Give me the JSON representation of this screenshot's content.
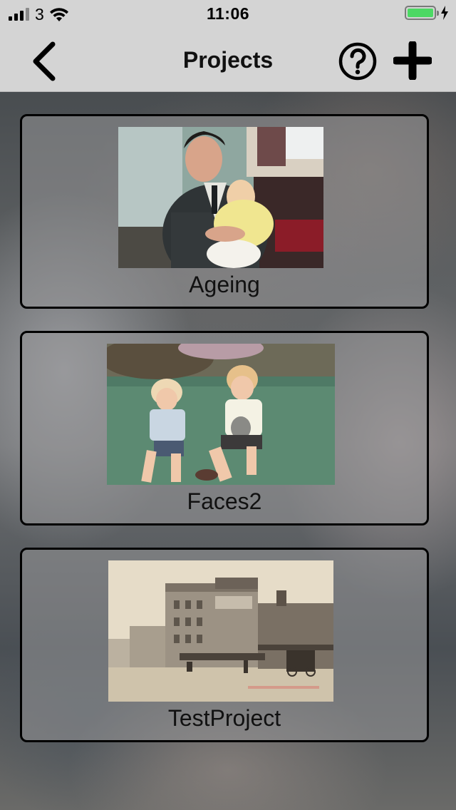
{
  "status_bar": {
    "carrier": "3",
    "time": "11:06",
    "signal_bars_filled": 3,
    "signal_bars_total": 4,
    "battery_level": 1.0,
    "battery_color": "#4cd964",
    "charging": true
  },
  "nav": {
    "title": "Projects",
    "back_icon": "chevron-left-icon",
    "help_icon": "question-circle-icon",
    "add_icon": "plus-icon"
  },
  "projects": [
    {
      "name": "Ageing",
      "thumbnail": "man-holding-baby-photo"
    },
    {
      "name": "Faces2",
      "thumbnail": "children-on-grass-photo"
    },
    {
      "name": "TestProject",
      "thumbnail": "street-postcard-photo"
    }
  ],
  "colors": {
    "bar_background": "#d4d4d4",
    "card_border": "#000000"
  }
}
